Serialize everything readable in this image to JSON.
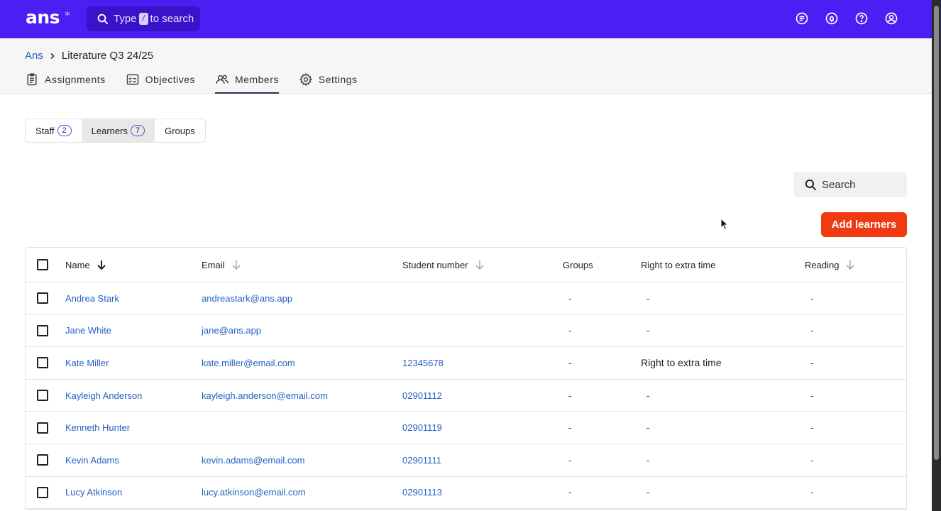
{
  "topbar": {
    "logo": "ans",
    "logo_star": "*",
    "search_prefix": "Type",
    "search_key": "/",
    "search_suffix": "to search"
  },
  "breadcrumb": {
    "root": "Ans",
    "current": "Literature Q3 24/25"
  },
  "tabs": [
    {
      "label": "Assignments",
      "icon": "clipboard-icon"
    },
    {
      "label": "Objectives",
      "icon": "checklist-icon"
    },
    {
      "label": "Members",
      "icon": "users-icon",
      "active": true
    },
    {
      "label": "Settings",
      "icon": "gear-icon"
    }
  ],
  "segments": {
    "staff": {
      "label": "Staff",
      "count": "2"
    },
    "learners": {
      "label": "Learners",
      "count": "7"
    },
    "groups": {
      "label": "Groups"
    }
  },
  "search": {
    "placeholder": "Search"
  },
  "add_button": "Add learners",
  "table": {
    "headers": {
      "name": "Name",
      "email": "Email",
      "student_number": "Student number",
      "groups": "Groups",
      "extra_time": "Right to extra time",
      "reading": "Reading"
    },
    "rows": [
      {
        "name": "Andrea Stark",
        "email": "andreastark@ans.app",
        "student_number": "",
        "groups": "-",
        "extra_time": "-",
        "reading": "-"
      },
      {
        "name": "Jane White",
        "email": "jane@ans.app",
        "student_number": "",
        "groups": "-",
        "extra_time": "-",
        "reading": "-"
      },
      {
        "name": "Kate Miller",
        "email": "kate.miller@email.com",
        "student_number": "12345678",
        "groups": "-",
        "extra_time": "Right to extra time",
        "reading": "-"
      },
      {
        "name": "Kayleigh Anderson",
        "email": "kayleigh.anderson@email.com",
        "student_number": "02901112",
        "groups": "-",
        "extra_time": "-",
        "reading": "-"
      },
      {
        "name": "Kenneth Hunter",
        "email": "",
        "student_number": "02901119",
        "groups": "-",
        "extra_time": "-",
        "reading": "-"
      },
      {
        "name": "Kevin Adams",
        "email": "kevin.adams@email.com",
        "student_number": "02901111",
        "groups": "-",
        "extra_time": "-",
        "reading": "-"
      },
      {
        "name": "Lucy Atkinson",
        "email": "lucy.atkinson@email.com",
        "student_number": "02901113",
        "groups": "-",
        "extra_time": "-",
        "reading": "-"
      }
    ]
  }
}
